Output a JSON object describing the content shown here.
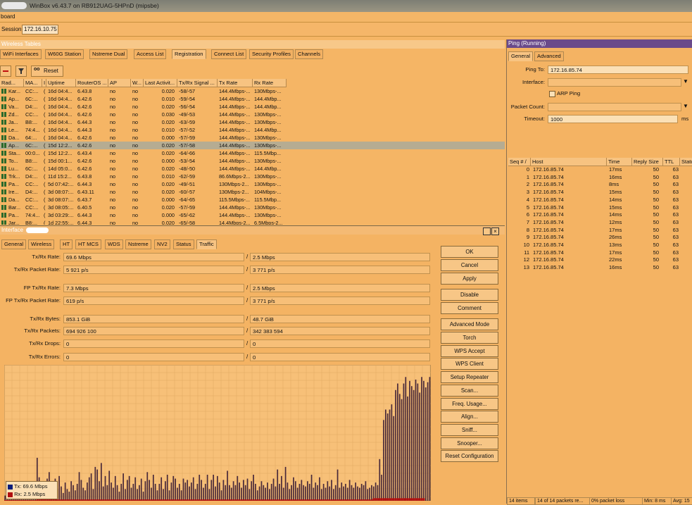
{
  "window": {
    "title": "WinBox v6.43.7 on RB912UAG-5HPnD (mipsbe)",
    "menu_text": "board"
  },
  "session": {
    "label": "Session:",
    "value": "172.16.10.75"
  },
  "wireless_tables": {
    "title": "Wireless Tables",
    "tabs": [
      "WiFi Interfaces",
      "W60G Station",
      "Nstreme Dual",
      "Access List",
      "Registration",
      "Connect List",
      "Security Profiles",
      "Channels"
    ],
    "active_tab": "Registration",
    "reset_label": "Reset",
    "columns": [
      "Rad...",
      "MA...",
      "I",
      "Uptime",
      "RouterOS ...",
      "AP",
      "W...",
      "Last Activit...",
      "Tx/Rx Signal ...",
      "Tx Rate",
      "Rx Rate"
    ],
    "rows": [
      [
        "Kar...",
        "CC:...",
        "(",
        "16d 04:4...",
        "6.43.8",
        "no",
        "no",
        "0.020",
        "-58/-57",
        "144.4Mbps-...",
        "130Mbps-..."
      ],
      [
        "Ap...",
        "6C:...",
        "(",
        "16d 04:4...",
        "6.42.6",
        "no",
        "no",
        "0.010",
        "-59/-54",
        "144.4Mbps-...",
        "144.4Mbp..."
      ],
      [
        "Va...",
        "D4:...",
        "(",
        "16d 04:4...",
        "6.42.6",
        "no",
        "no",
        "0.020",
        "-56/-54",
        "144.4Mbps-...",
        "144.4Mbp..."
      ],
      [
        "Zd...",
        "CC:...",
        "(",
        "16d 04:4...",
        "6.42.6",
        "no",
        "no",
        "0.030",
        "-49/-53",
        "144.4Mbps-...",
        "130Mbps-..."
      ],
      [
        "Ja...",
        "B8:...",
        "(",
        "16d 04:4...",
        "6.44.3",
        "no",
        "no",
        "0.020",
        "-63/-59",
        "144.4Mbps-...",
        "130Mbps-..."
      ],
      [
        "Le...",
        "74:4...",
        "(",
        "16d 04:4...",
        "6.44.3",
        "no",
        "no",
        "0.010",
        "-57/-52",
        "144.4Mbps-...",
        "144.4Mbp..."
      ],
      [
        "Da...",
        "64:...",
        "(",
        "16d 04:4...",
        "6.42.6",
        "no",
        "no",
        "0.000",
        "-57/-59",
        "144.4Mbps-...",
        "130Mbps-..."
      ],
      [
        "Ap...",
        "6C:...",
        "(",
        "15d 12:2...",
        "6.42.6",
        "no",
        "no",
        "0.020",
        "-57/-58",
        "144.4Mbps-...",
        "130Mbps-..."
      ],
      [
        "Sta...",
        "00:0...",
        "(",
        "15d 12:2...",
        "6.43.4",
        "no",
        "no",
        "0.020",
        "-64/-66",
        "144.4Mbps-...",
        "115.5Mbp..."
      ],
      [
        "To...",
        "B8:...",
        "(",
        "15d 00:1...",
        "6.42.6",
        "no",
        "no",
        "0.000",
        "-53/-54",
        "144.4Mbps-...",
        "130Mbps-..."
      ],
      [
        "Lu...",
        "6C:...",
        "(",
        "14d 05:0...",
        "6.42.6",
        "no",
        "no",
        "0.020",
        "-48/-50",
        "144.4Mbps-...",
        "144.4Mbp..."
      ],
      [
        "Trk...",
        "D4:...",
        "(",
        "11d 15:2...",
        "6.43.8",
        "no",
        "no",
        "0.010",
        "-62/-59",
        "86.6Mbps-2...",
        "130Mbps-..."
      ],
      [
        "Pa...",
        "CC:...",
        "(",
        "5d 07:42:...",
        "6.44.3",
        "no",
        "no",
        "0.020",
        "-49/-51",
        "130Mbps-2...",
        "130Mbps-..."
      ],
      [
        "Ire...",
        "D4:...",
        "(",
        "3d 08:07:...",
        "6.43.11",
        "no",
        "no",
        "0.020",
        "-60/-57",
        "130Mbps-2...",
        "104Mbps-..."
      ],
      [
        "Da...",
        "CC:...",
        "(",
        "3d 08:07:...",
        "6.43.7",
        "no",
        "no",
        "0.000",
        "-64/-65",
        "115.5Mbps-...",
        "115.5Mbp..."
      ],
      [
        "Bar...",
        "CC:...",
        "(",
        "3d 08:05:...",
        "6.40.5",
        "no",
        "no",
        "0.020",
        "-57/-59",
        "144.4Mbps-...",
        "130Mbps-..."
      ],
      [
        "Pa...",
        "74:4...",
        "(",
        "3d 03:29:...",
        "6.44.3",
        "no",
        "no",
        "0.000",
        "-65/-62",
        "144.4Mbps-...",
        "130Mbps-..."
      ],
      [
        "Jar...",
        "B8:...",
        "(",
        "1d 22:55:...",
        "6.44.3",
        "no",
        "no",
        "0.020",
        "-65/-58",
        "14.4Mbps-2...",
        "6.5Mbps-2..."
      ]
    ]
  },
  "interface": {
    "title": "Interface",
    "tabs": [
      "General",
      "Wireless",
      "HT",
      "HT MCS",
      "WDS",
      "Nstreme",
      "NV2",
      "Status",
      "Traffic"
    ],
    "active_tab": "Traffic",
    "fields": [
      {
        "label": "Tx/Rx Rate:",
        "tx": "69.6 Mbps",
        "rx": "2.5 Mbps"
      },
      {
        "label": "Tx/Rx Packet Rate:",
        "tx": "5 921 p/s",
        "rx": "3 771 p/s"
      },
      {
        "label": "FP Tx/Rx Rate:",
        "tx": "7.3 Mbps",
        "rx": "2.5 Mbps"
      },
      {
        "label": "FP Tx/Rx Packet Rate:",
        "tx": "619 p/s",
        "rx": "3 771 p/s"
      },
      {
        "label": "Tx/Rx Bytes:",
        "tx": "853.1 GiB",
        "rx": "48.7 GiB"
      },
      {
        "label": "Tx/Rx Packets:",
        "tx": "694 926 100",
        "rx": "342 383 594"
      },
      {
        "label": "Tx/Rx Drops:",
        "tx": "0",
        "rx": "0"
      },
      {
        "label": "Tx/Rx Errors:",
        "tx": "0",
        "rx": "0"
      }
    ],
    "separator": "/",
    "buttons": [
      "OK",
      "Cancel",
      "Apply",
      "Disable",
      "Comment",
      "Advanced Mode",
      "Torch",
      "WPS Accept",
      "WPS Client",
      "Setup Repeater",
      "Scan...",
      "Freq. Usage...",
      "Align...",
      "Sniff...",
      "Snooper...",
      "Reset Configuration"
    ],
    "legend": [
      {
        "label": "Tx:",
        "value": "69.6 Mbps",
        "color": "#0a1e7a"
      },
      {
        "label": "Rx:",
        "value": "2.5 Mbps",
        "color": "#b01010"
      }
    ],
    "window_icons": [
      "restore-icon",
      "close-icon"
    ]
  },
  "chart_data": {
    "type": "bar",
    "series": [
      {
        "name": "Tx",
        "color": "#4a2a3a",
        "values": [
          0.04,
          0.03,
          0.05,
          0.04,
          0.06,
          0.03,
          0.04,
          0.05,
          0.03,
          0.04,
          0.05,
          0.06,
          0.04,
          0.03,
          0.05,
          0.04,
          0.33,
          0.18,
          0.06,
          0.12,
          0.09,
          0.17,
          0.22,
          0.08,
          0.13,
          0.17,
          0.09,
          0.19,
          0.11,
          0.06,
          0.14,
          0.09,
          0.07,
          0.15,
          0.12,
          0.08,
          0.13,
          0.22,
          0.16,
          0.1,
          0.08,
          0.14,
          0.18,
          0.21,
          0.09,
          0.26,
          0.24,
          0.15,
          0.29,
          0.11,
          0.19,
          0.12,
          0.23,
          0.14,
          0.1,
          0.19,
          0.12,
          0.07,
          0.13,
          0.21,
          0.09,
          0.16,
          0.19,
          0.1,
          0.13,
          0.18,
          0.09,
          0.12,
          0.17,
          0.07,
          0.15,
          0.22,
          0.16,
          0.1,
          0.2,
          0.13,
          0.08,
          0.13,
          0.18,
          0.09,
          0.15,
          0.2,
          0.08,
          0.14,
          0.19,
          0.17,
          0.1,
          0.13,
          0.08,
          0.17,
          0.14,
          0.16,
          0.11,
          0.14,
          0.18,
          0.09,
          0.13,
          0.2,
          0.16,
          0.1,
          0.13,
          0.2,
          0.09,
          0.16,
          0.2,
          0.11,
          0.19,
          0.14,
          0.08,
          0.16,
          0.12,
          0.23,
          0.12,
          0.1,
          0.15,
          0.12,
          0.19,
          0.14,
          0.1,
          0.16,
          0.12,
          0.17,
          0.09,
          0.15,
          0.2,
          0.13,
          0.08,
          0.11,
          0.15,
          0.12,
          0.1,
          0.14,
          0.09,
          0.13,
          0.17,
          0.11,
          0.24,
          0.13,
          0.19,
          0.1,
          0.26,
          0.14,
          0.09,
          0.12,
          0.18,
          0.15,
          0.1,
          0.13,
          0.16,
          0.12,
          0.11,
          0.15,
          0.13,
          0.2,
          0.1,
          0.14,
          0.12,
          0.18,
          0.09,
          0.13,
          0.1,
          0.15,
          0.11,
          0.16,
          0.09,
          0.12,
          0.24,
          0.1,
          0.14,
          0.11,
          0.13,
          0.1,
          0.16,
          0.12,
          0.1,
          0.14,
          0.11,
          0.1,
          0.13,
          0.12,
          0.15,
          0.09,
          0.1,
          0.12,
          0.11,
          0.14,
          0.12,
          0.32,
          0.2,
          0.62,
          0.7,
          0.67,
          0.7,
          0.74,
          0.65,
          0.85,
          0.9,
          0.82,
          0.78,
          0.9,
          0.95,
          0.8,
          0.92,
          0.88,
          0.85,
          0.93,
          0.9,
          0.83,
          0.95,
          0.92,
          0.87,
          0.91,
          0.95
        ]
      },
      {
        "name": "Rx",
        "color": "#b01010",
        "values": [
          0.005,
          0.005,
          0.005,
          0.005,
          0.005,
          0.005,
          0.005,
          0.005,
          0.005,
          0.005,
          0.005,
          0.005,
          0.005,
          0.005,
          0.005,
          0.005,
          0.01,
          0.01,
          0.01,
          0.01,
          0.01,
          0.01,
          0.01,
          0.01,
          0.01,
          0.01,
          0.01,
          0.01,
          0.01,
          0.01,
          0.01,
          0.01,
          0.01,
          0.01,
          0.01,
          0.01,
          0.01,
          0.01,
          0.01,
          0.01,
          0.01,
          0.01,
          0.01,
          0.01,
          0.01,
          0.01,
          0.01,
          0.01,
          0.01,
          0.01,
          0.01,
          0.01,
          0.01,
          0.01,
          0.01,
          0.01,
          0.01,
          0.01,
          0.01,
          0.01,
          0.01,
          0.01,
          0.01,
          0.01,
          0.01,
          0.01,
          0.01,
          0.01,
          0.01,
          0.01,
          0.01,
          0.01,
          0.01,
          0.01,
          0.01,
          0.01,
          0.01,
          0.01,
          0.01,
          0.01,
          0.01,
          0.01,
          0.01,
          0.01,
          0.01,
          0.01,
          0.01,
          0.01,
          0.01,
          0.01,
          0.01,
          0.01,
          0.01,
          0.01,
          0.01,
          0.01,
          0.01,
          0.01,
          0.01,
          0.01,
          0.01,
          0.01,
          0.01,
          0.01,
          0.01,
          0.01,
          0.01,
          0.01,
          0.01,
          0.01,
          0.01,
          0.01,
          0.01,
          0.01,
          0.01,
          0.01,
          0.01,
          0.01,
          0.01,
          0.01,
          0.01,
          0.01,
          0.01,
          0.01,
          0.01,
          0.01,
          0.01,
          0.01,
          0.01,
          0.01,
          0.01,
          0.01,
          0.01,
          0.01,
          0.01,
          0.01,
          0.01,
          0.01,
          0.01,
          0.01,
          0.01,
          0.01,
          0.01,
          0.01,
          0.01,
          0.01,
          0.01,
          0.01,
          0.01,
          0.01,
          0.01,
          0.01,
          0.01,
          0.01,
          0.01,
          0.01,
          0.01,
          0.01,
          0.01,
          0.01,
          0.01,
          0.01,
          0.01,
          0.01,
          0.01,
          0.01,
          0.01,
          0.01,
          0.01,
          0.01,
          0.01,
          0.01,
          0.01,
          0.01,
          0.01,
          0.01,
          0.01,
          0.01,
          0.01,
          0.01,
          0.01,
          0.01,
          0.01,
          0.01,
          0.02,
          0.02,
          0.02,
          0.02,
          0.02,
          0.02,
          0.02,
          0.02,
          0.02,
          0.02,
          0.02,
          0.02,
          0.02,
          0.02,
          0.02,
          0.02,
          0.02,
          0.02,
          0.02,
          0.02,
          0.02,
          0.02,
          0.02,
          0.02,
          0.02,
          0.02
        ]
      }
    ],
    "grid": true,
    "legend_position": "bottom-left"
  },
  "ping": {
    "title": "Ping (Running)",
    "tabs": [
      "General",
      "Advanced"
    ],
    "active_tab": "General",
    "ping_to_label": "Ping To:",
    "ping_to": "172.16.85.74",
    "interface_label": "Interface:",
    "arp_ping_label": "ARP Ping",
    "packet_count_label": "Packet Count:",
    "timeout_label": "Timeout:",
    "timeout": "1000",
    "timeout_unit": "ms",
    "columns": [
      "Seq # /",
      "Host",
      "Time",
      "Reply Size",
      "TTL",
      "Statu"
    ],
    "rows": [
      [
        "0",
        "172.16.85.74",
        "17ms",
        "50",
        "63"
      ],
      [
        "1",
        "172.16.85.74",
        "16ms",
        "50",
        "63"
      ],
      [
        "2",
        "172.16.85.74",
        "8ms",
        "50",
        "63"
      ],
      [
        "3",
        "172.16.85.74",
        "15ms",
        "50",
        "63"
      ],
      [
        "4",
        "172.16.85.74",
        "14ms",
        "50",
        "63"
      ],
      [
        "5",
        "172.16.85.74",
        "15ms",
        "50",
        "63"
      ],
      [
        "6",
        "172.16.85.74",
        "14ms",
        "50",
        "63"
      ],
      [
        "7",
        "172.16.85.74",
        "12ms",
        "50",
        "63"
      ],
      [
        "8",
        "172.16.85.74",
        "17ms",
        "50",
        "63"
      ],
      [
        "9",
        "172.16.85.74",
        "26ms",
        "50",
        "63"
      ],
      [
        "10",
        "172.16.85.74",
        "13ms",
        "50",
        "63"
      ],
      [
        "11",
        "172.16.85.74",
        "17ms",
        "50",
        "63"
      ],
      [
        "12",
        "172.16.85.74",
        "22ms",
        "50",
        "63"
      ],
      [
        "13",
        "172.16.85.74",
        "16ms",
        "50",
        "63"
      ]
    ],
    "status": [
      "14 items",
      "14 of 14 packets re...",
      "0% packet loss",
      "Min: 8 ms",
      "Avg: 15"
    ]
  }
}
